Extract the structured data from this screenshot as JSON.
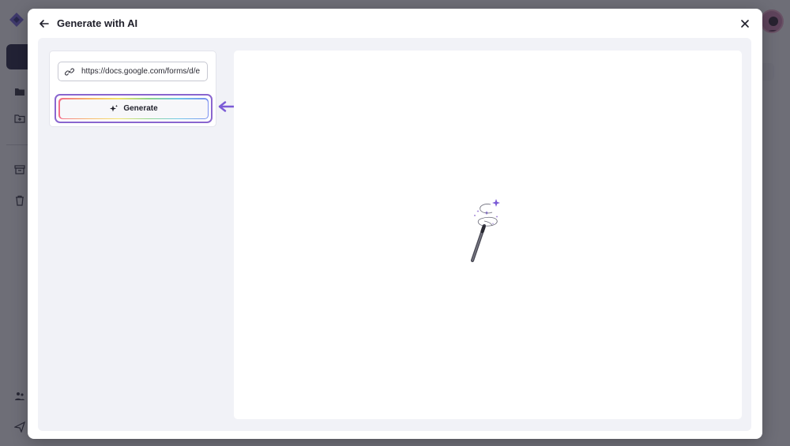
{
  "modal": {
    "title": "Generate with AI",
    "url_value": "https://docs.google.com/forms/d/e",
    "generate_label": "Generate"
  },
  "colors": {
    "accent": "#8a66cf",
    "arrow": "#7b5bd6",
    "navy": "#1a1a3a"
  },
  "icons": {
    "back": "arrow-left-icon",
    "close": "close-icon",
    "link": "link-icon",
    "sparkle": "sparkle-icon",
    "wand": "magic-wand-icon"
  }
}
